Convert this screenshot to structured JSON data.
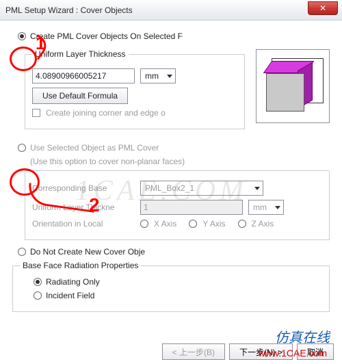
{
  "window": {
    "title": "PML Setup Wizard : Cover Objects",
    "close_glyph": "✕"
  },
  "opt1": {
    "label": "Create PML Cover Objects On Selected F",
    "group_title": "Uniform Layer Thickness",
    "thickness_value": "4.08900966005217",
    "unit": "mm",
    "default_btn": "Use Default Formula",
    "joining_label": "Create joining corner and edge o"
  },
  "opt2": {
    "label": "Use Selected Object as PML Cover",
    "note": "(Use this option to cover non-planar faces)",
    "base_label": "Corresponding Base",
    "base_value": "PML_Box2_1",
    "thk_label": "Uniform Layer Thickne",
    "thk_value": "1",
    "thk_unit": "mm",
    "orient_label": "Orientation in Local",
    "axis_x": "X Axis",
    "axis_y": "Y Axis",
    "axis_z": "Z Axis"
  },
  "opt3": {
    "label": "Do Not Create New Cover Obje"
  },
  "base_face": {
    "group_title": "Base Face Radiation Properties",
    "radiating": "Radiating Only",
    "incident": "Incident Field"
  },
  "footer": {
    "back": "< 上一步(B)",
    "next": "下一步(N) >",
    "cancel": "取消"
  },
  "annotations": {
    "n1": "1",
    "n2": "2",
    "wm1": "1CAE.COM",
    "wm2": "仿真在线",
    "wm3": "www.1CAE.com"
  }
}
